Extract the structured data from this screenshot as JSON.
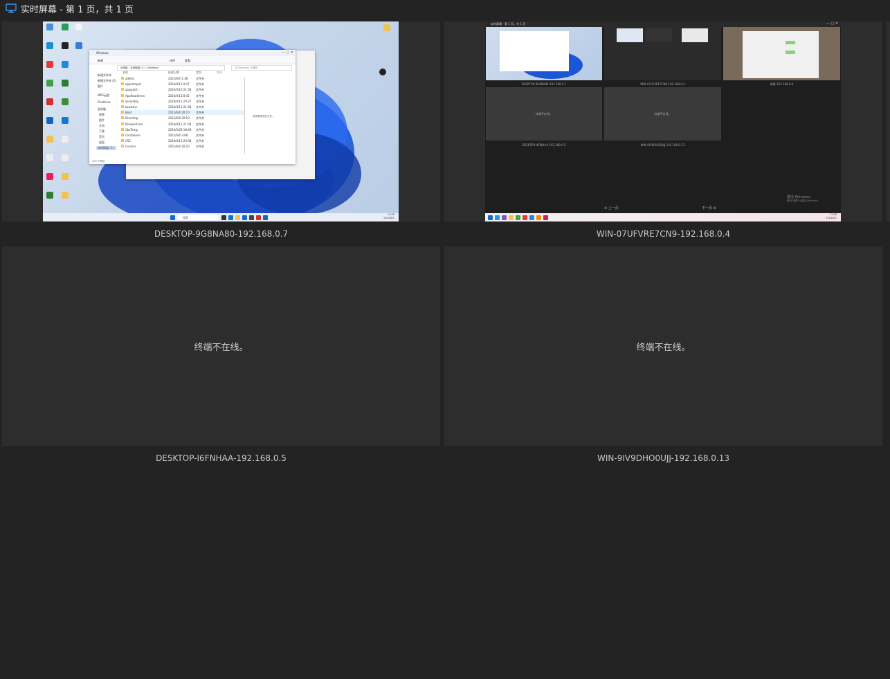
{
  "window": {
    "title": "实时屏幕 - 第 1 页，共 1 页",
    "icon": "monitor-icon",
    "accent": "#3b8ee8"
  },
  "tiles": [
    {
      "name": "DESKTOP-9G8NA80-192.168.0.7",
      "online": true
    },
    {
      "name": "WIN-07UFVRE7CN9-192.168.0.4",
      "online": true
    },
    {
      "name": "DESKTOP-I6FNHAA-192.168.0.5",
      "online": false,
      "status": "终端不在线。"
    },
    {
      "name": "WIN-9IV9DHO0UJJ-192.168.0.13",
      "online": false,
      "status": "终端不在线。"
    }
  ],
  "shot1": {
    "window_title": "Windows",
    "new_label": "新建",
    "sort_label": "排序",
    "view_label": "查看",
    "breadcrumb": [
      "此电脑",
      "本地磁盘 (C:)",
      "Windows"
    ],
    "search_placeholder": "在 Windows 中搜索",
    "headers": [
      "名称",
      "修改日期",
      "类型",
      "大小"
    ],
    "rows": [
      [
        "addins",
        "2021/6/6 1:38",
        "文件夹"
      ],
      [
        "appcompat",
        "2024/4/11 8:47",
        "文件夹"
      ],
      [
        "apppatch",
        "2024/4/13 21:58",
        "文件夹"
      ],
      [
        "AppReadiness",
        "2024/4/13 8:42",
        "文件夹"
      ],
      [
        "assembly",
        "2024/4/13 20:37",
        "文件夹"
      ],
      [
        "bcastdvr",
        "2024/4/13 21:58",
        "文件夹"
      ],
      [
        "Boot",
        "2021/6/6 20:10",
        "文件夹"
      ],
      [
        "Branding",
        "2021/6/6 20:10",
        "文件夹"
      ],
      [
        "BrowserCore",
        "2024/4/13 21:58",
        "文件夹"
      ],
      [
        "CbsTemp",
        "2024/5/28 18:49",
        "文件夹"
      ],
      [
        "Containers",
        "2021/6/6 3:08",
        "文件夹"
      ],
      [
        "CSC",
        "2024/4/13 20:08",
        "文件夹"
      ],
      [
        "Cursors",
        "2021/6/6 20:10",
        "文件夹"
      ]
    ],
    "nav": [
      "新建文件夹",
      "新建文件夹 (2)",
      "图片",
      "WPS云盘",
      "OneDrive",
      "此电脑",
      "视频",
      "图片",
      "文档",
      "下载",
      "音乐",
      "桌面",
      "本地磁盘 (C:)"
    ],
    "preview_hint": "选择要预览的文件。",
    "status_text": "103 个项目",
    "taskbar_search": "搜索",
    "clock_time": "13:08",
    "clock_date": "2024/6/1"
  },
  "shot2": {
    "title": "实时屏幕 - 第 1 页，共 1 页",
    "labels": [
      "DESKTOP-9G8NA80-192.168.0.7",
      "WIN-07UFVRE7CN9-192.168.0.4",
      "易联-192.168.0.6",
      "DESKTOP-I6FNHAA-192.168.0.5",
      "WIN-9IV9DHO0UJJ-192.168.0.13"
    ],
    "offline_text": "终端不在线。",
    "prev_label": "上一页",
    "next_label": "下一页",
    "watermark_title": "激活 Windows",
    "watermark_sub": "转到\"设置\"以激活 Windows。",
    "clock_time": "13:08",
    "clock_date": "2024/6/1"
  }
}
